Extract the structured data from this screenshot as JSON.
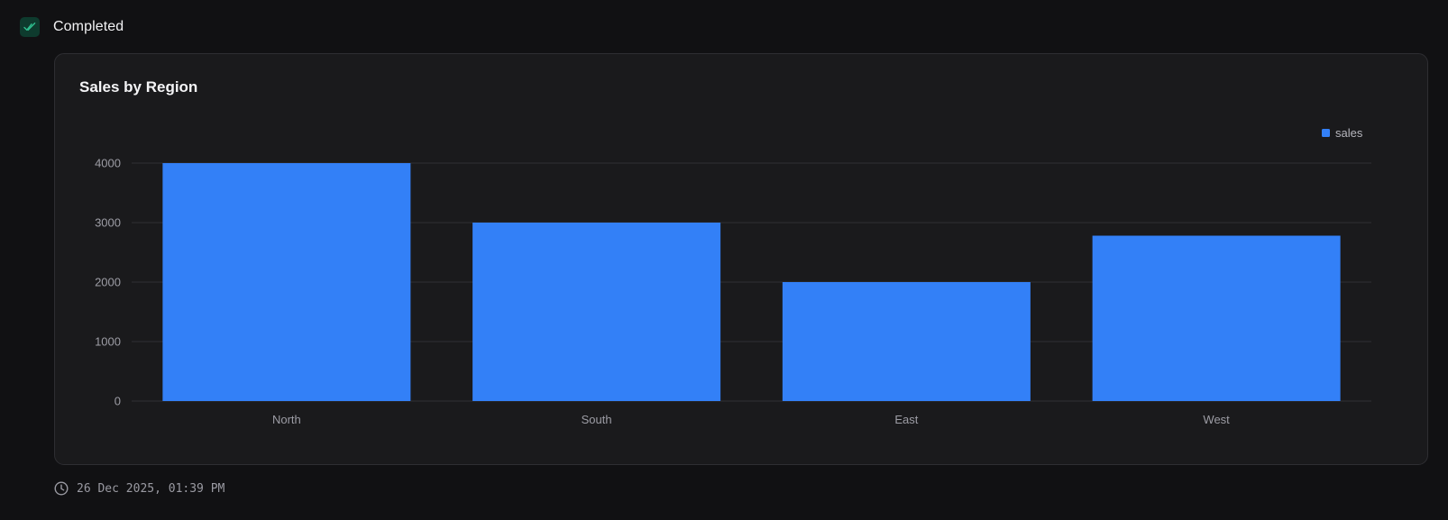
{
  "status": {
    "label": "Completed",
    "icon": "double-check-icon",
    "color": "#2fbf8f"
  },
  "card": {
    "title": "Sales by Region"
  },
  "footer": {
    "icon": "clock-icon",
    "timestamp": "26 Dec 2025, 01:39 PM"
  },
  "chart_data": {
    "type": "bar",
    "title": "Sales by Region",
    "categories": [
      "North",
      "South",
      "East",
      "West"
    ],
    "series": [
      {
        "name": "sales",
        "values": [
          4000,
          3000,
          2000,
          2780
        ],
        "color": "#3380f7"
      }
    ],
    "ylim": [
      0,
      4000
    ],
    "yticks": [
      0,
      1000,
      2000,
      3000,
      4000
    ],
    "xlabel": "",
    "ylabel": "",
    "grid": true,
    "legend": "top-right"
  }
}
